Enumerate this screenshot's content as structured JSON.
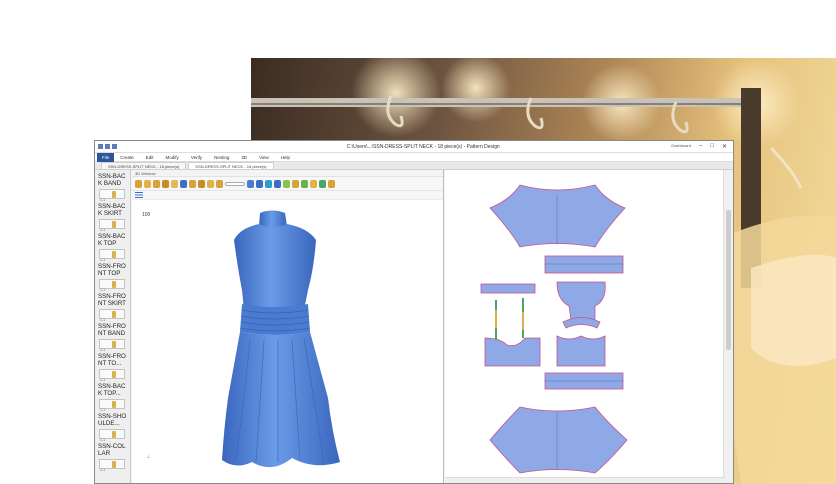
{
  "window": {
    "title": "C:\\Users\\...\\SSN-DRESS-SPLIT NECK - 18 piece(s) - Pattern Design",
    "right_status": "Dashboard"
  },
  "menu": {
    "file": "File",
    "items": [
      "Create",
      "Edit",
      "Modify",
      "Verify",
      "Nesting",
      "3D",
      "View",
      "Help"
    ]
  },
  "tabs": [
    "SSN-DRESS-SPLIT NECK - 18 piece(s)",
    "SSN-DRESS-SPLIT NECK - 18 piece(s)"
  ],
  "pane3d": {
    "title": "3D Window",
    "zoom": "100"
  },
  "pieces": [
    {
      "label": "SSN-BAC K BAND",
      "num": "1-1"
    },
    {
      "label": "SSN-BAC K SKIRT",
      "num": "1-1"
    },
    {
      "label": "SSN-BAC K TOP",
      "num": "1-1"
    },
    {
      "label": "SSN-FRO NT TOP",
      "num": "1-1"
    },
    {
      "label": "SSN-FRO NT SKIRT",
      "num": "1-1"
    },
    {
      "label": "SSN-FRO NT BAND",
      "num": "1-1"
    },
    {
      "label": "SSN-FRO NT TO...",
      "num": "1-1"
    },
    {
      "label": "SSN-BAC K TOP...",
      "num": "1-1"
    },
    {
      "label": "SSN-SHO ULDE...",
      "num": "1-1"
    },
    {
      "label": "SSN-COL LAR",
      "num": "1-1"
    }
  ],
  "colors": {
    "fabric": "#5b8ee0",
    "fabric_dark": "#3f70c4",
    "pattern_fill": "#8ea9e6",
    "pattern_stroke": "#d04a8a",
    "file_tab": "#2b579a"
  }
}
